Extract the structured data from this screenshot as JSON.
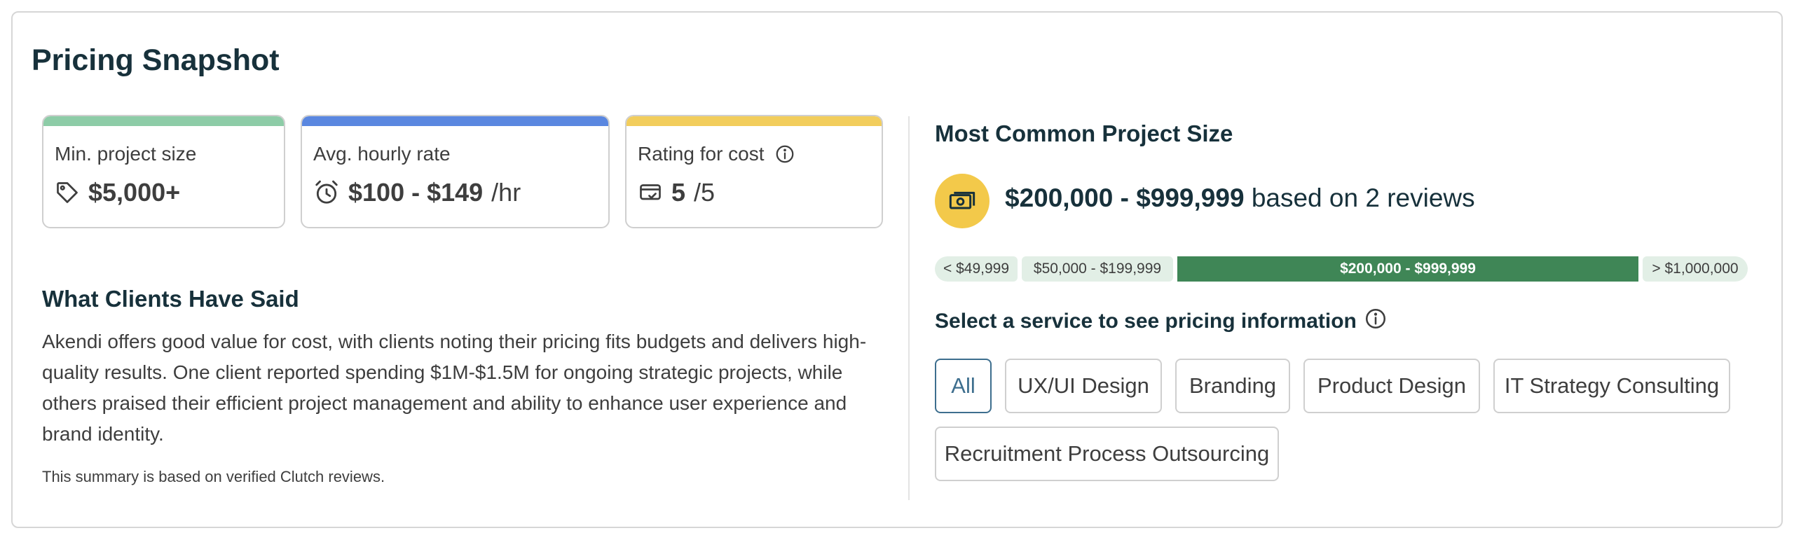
{
  "title": "Pricing Snapshot",
  "metrics": {
    "min_project": {
      "label": "Min. project size",
      "value": "$5,000+",
      "icon": "tag-icon",
      "color": "#8dcca7"
    },
    "hourly": {
      "label": "Avg. hourly rate",
      "value": "$100 - $149",
      "unit": "/hr",
      "icon": "alarm-clock-icon",
      "color": "#5a87e0"
    },
    "rating": {
      "label": "Rating for cost",
      "value": "5",
      "unit": "/5",
      "icon": "card-check-icon",
      "color": "#f2cd5c"
    }
  },
  "clients": {
    "heading": "What Clients Have Said",
    "summary": "Akendi offers good value for cost, with clients noting their pricing fits budgets and delivers high-quality results. One client reported spending $1M-$1.5M for ongoing strategic projects, while others praised their efficient project management and ability to enhance user experience and brand identity.",
    "footnote": "This summary is based on verified Clutch reviews."
  },
  "project_size": {
    "heading": "Most Common Project Size",
    "range": "$200,000 - $999,999",
    "suffix": "based on 2 reviews",
    "segments": [
      {
        "label": "< $49,999",
        "active": false
      },
      {
        "label": "$50,000 - $199,999",
        "active": false
      },
      {
        "label": "$200,000 - $999,999",
        "active": true
      },
      {
        "label": "> $1,000,000",
        "active": false
      }
    ],
    "accent": "#3f8656"
  },
  "services": {
    "label": "Select a service to see pricing information",
    "chips": [
      "All",
      "UX/UI Design",
      "Branding",
      "Product Design",
      "IT Strategy Consulting",
      "Recruitment Process Outsourcing"
    ],
    "selected": "All"
  }
}
